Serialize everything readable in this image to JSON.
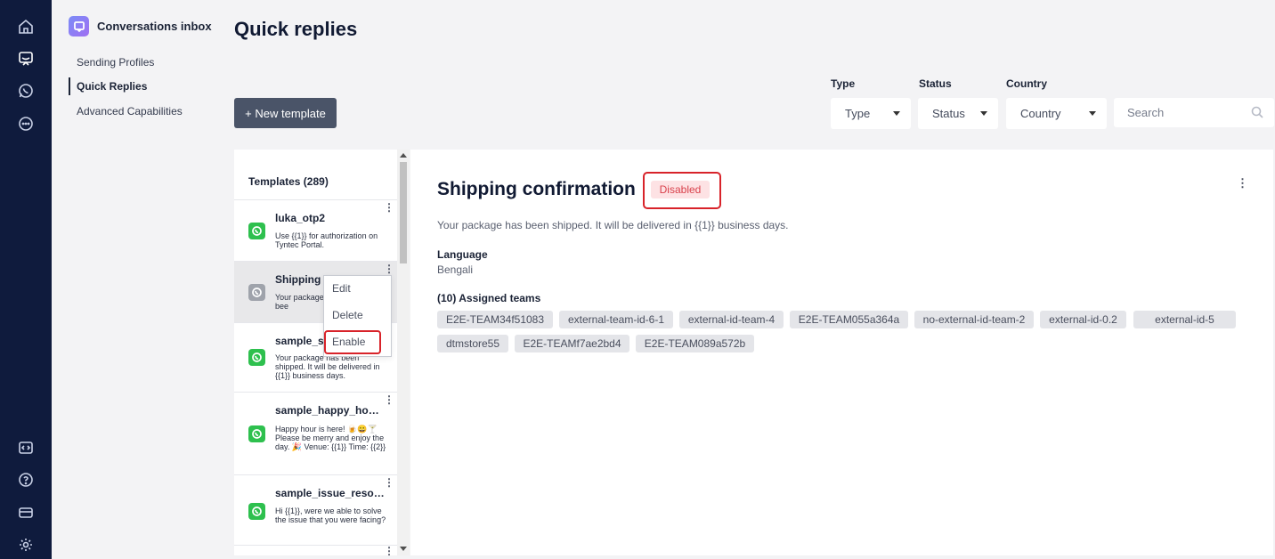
{
  "rail": {
    "icons": [
      "home-icon",
      "inbox-icon",
      "whatsapp-icon",
      "chat-icon",
      "code-icon",
      "help-icon",
      "billing-icon",
      "settings-icon"
    ]
  },
  "nav": {
    "app_title": "Conversations inbox",
    "items": [
      {
        "label": "Sending Profiles",
        "active": false
      },
      {
        "label": "Quick Replies",
        "active": true
      },
      {
        "label": "Advanced Capabilities",
        "active": false
      }
    ]
  },
  "page": {
    "title": "Quick replies",
    "new_template_label": "+ New template"
  },
  "filters": {
    "type": {
      "label": "Type",
      "value": "Type"
    },
    "status": {
      "label": "Status",
      "value": "Status"
    },
    "country": {
      "label": "Country",
      "value": "Country"
    },
    "search_placeholder": "Search"
  },
  "templates": {
    "header": "Templates (289)",
    "items": [
      {
        "name": "luka_otp2",
        "body": "Use {{1}} for authorization on Tyntec Portal."
      },
      {
        "name": "Shipping c",
        "body": "Your package",
        "body2": "bee"
      },
      {
        "name": "sample_sh",
        "body": "Your package has been shipped. It will be delivered in {{1}} business days."
      },
      {
        "name": "sample_happy_hour_...",
        "body": "Happy hour is here! 🍺😀🍸 Please be merry and enjoy the day. 🎉 Venue: {{1}} Time: {{2}}"
      },
      {
        "name": "sample_issue_resolut...",
        "body": "Hi {{1}}, were we able to solve the issue that you were facing?"
      }
    ]
  },
  "context_menu": {
    "items": [
      "Edit",
      "Delete",
      "Enable"
    ]
  },
  "detail": {
    "title": "Shipping confirmation",
    "status": "Disabled",
    "description": "Your package has been shipped. It will be delivered in {{1}} business days.",
    "language_label": "Language",
    "language_value": "Bengali",
    "teams_label": "(10) Assigned teams",
    "teams": [
      "E2E-TEAM34f51083",
      "external-team-id-6-1",
      "external-id-team-4",
      "E2E-TEAM055a364a",
      "no-external-id-team-2",
      "external-id-0.2",
      "external-id-5",
      "dtmstore55",
      "E2E-TEAMf7ae2bd4",
      "E2E-TEAM089a572b"
    ]
  },
  "colors": {
    "rail_bg": "#0f1b3d",
    "primary_button": "#4a5468",
    "whatsapp_green": "#2ec04e",
    "disabled_badge_bg": "#fde2e4",
    "disabled_badge_text": "#d9424c",
    "highlight_red": "#d8232a"
  }
}
